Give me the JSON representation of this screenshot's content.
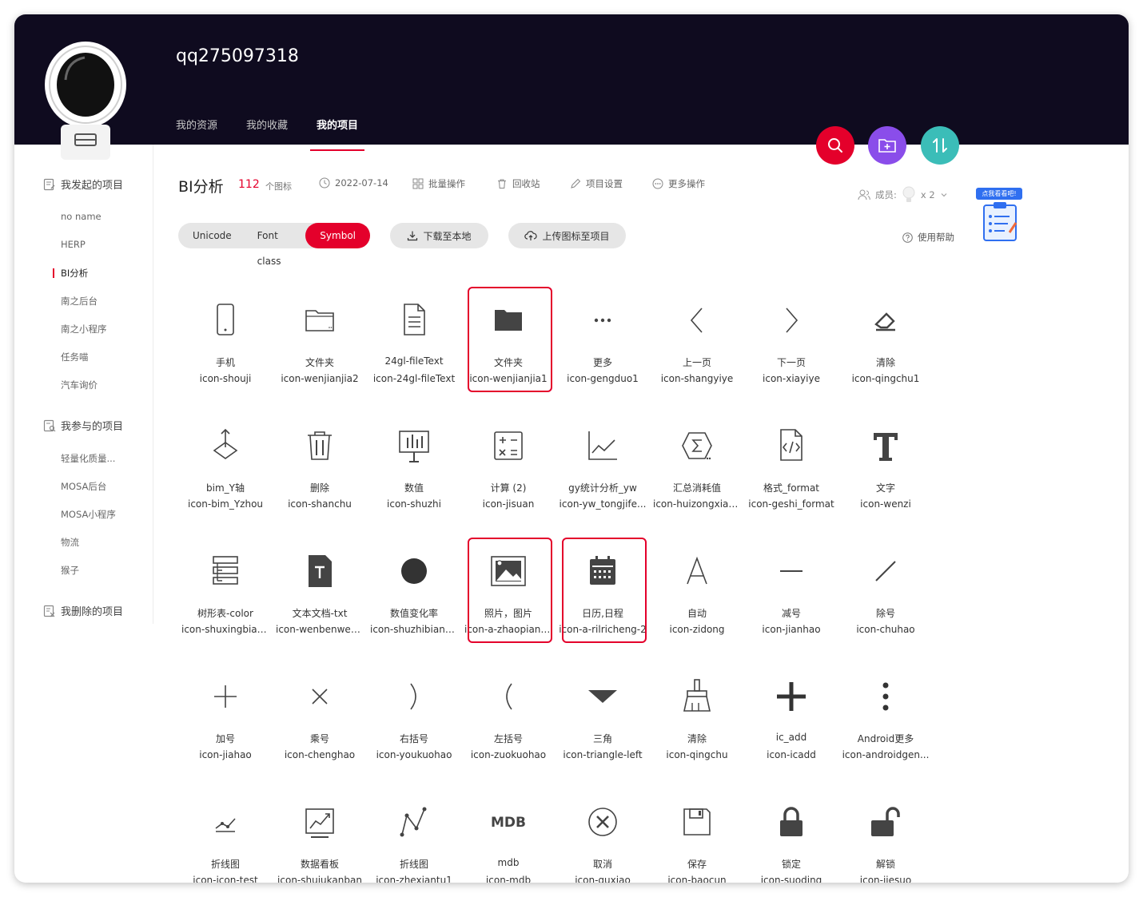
{
  "header": {
    "username": "qq275097318",
    "tabs": [
      {
        "label": "我的资源"
      },
      {
        "label": "我的收藏"
      },
      {
        "label": "我的项目"
      }
    ]
  },
  "sidebar": {
    "group_started": "我发起的项目",
    "started_items": [
      "no name",
      "HERP",
      "BI分析",
      "南之后台",
      "南之小程序",
      "任务喵",
      "汽车询价"
    ],
    "group_joined": "我参与的项目",
    "joined_items": [
      "轻量化质量...",
      "MOSA后台",
      "MOSA小程序",
      "物流",
      "猴子"
    ],
    "group_deleted": "我删除的项目"
  },
  "project": {
    "title": "BI分析",
    "count": "112",
    "count_unit": "个图标",
    "date": "2022-07-14",
    "batch": "批量操作",
    "recycle": "回收站",
    "settings": "项目设置",
    "more": "更多操作",
    "members_label": "成员:",
    "members_count": "x 2",
    "help": "使用帮助",
    "promo": "点我看看吧!"
  },
  "toolbar": {
    "unicode": "Unicode",
    "font_class": "Font class",
    "symbol": "Symbol",
    "download": "下载至本地",
    "upload": "上传图标至项目"
  },
  "icons": [
    {
      "name": "手机",
      "code": "icon-shouji",
      "glyph": "phone-icon"
    },
    {
      "name": "文件夹",
      "code": "icon-wenjianjia2",
      "glyph": "folder-outline-icon"
    },
    {
      "name": "24gl-fileText",
      "code": "icon-24gl-fileText",
      "glyph": "file-text-icon"
    },
    {
      "name": "文件夹",
      "code": "icon-wenjianjia1",
      "glyph": "folder-filled-icon"
    },
    {
      "name": "更多",
      "code": "icon-gengduo1",
      "glyph": "more-dots-icon"
    },
    {
      "name": "上一页",
      "code": "icon-shangyiye",
      "glyph": "chevron-left-icon"
    },
    {
      "name": "下一页",
      "code": "icon-xiayiye",
      "glyph": "chevron-right-icon"
    },
    {
      "name": "清除",
      "code": "icon-qingchu1",
      "glyph": "eraser-icon"
    },
    {
      "name": "bim_Y轴",
      "code": "icon-bim_Yzhou",
      "glyph": "axis-y-icon"
    },
    {
      "name": "删除",
      "code": "icon-shanchu",
      "glyph": "trash-icon"
    },
    {
      "name": "数值",
      "code": "icon-shuzhi",
      "glyph": "presentation-chart-icon"
    },
    {
      "name": "计算 (2)",
      "code": "icon-jisuan",
      "glyph": "calculator-icon"
    },
    {
      "name": "gy统计分析_yw",
      "code": "icon-yw_tongjife...",
      "glyph": "line-chart-icon"
    },
    {
      "name": "汇总消耗值",
      "code": "icon-huizongxiao...",
      "glyph": "sum-icon"
    },
    {
      "name": "格式_format",
      "code": "icon-geshi_format",
      "glyph": "code-file-icon"
    },
    {
      "name": "文字",
      "code": "icon-wenzi",
      "glyph": "text-t-icon"
    },
    {
      "name": "树形表-color",
      "code": "icon-shuxingbiao...",
      "glyph": "tree-table-icon"
    },
    {
      "name": "文本文档-txt",
      "code": "icon-wenbenwen...",
      "glyph": "txt-document-icon"
    },
    {
      "name": "数值变化率",
      "code": "icon-shuzhibianh...",
      "glyph": "filled-circle-icon"
    },
    {
      "name": "照片，图片",
      "code": "icon-a-zhaopiant...",
      "glyph": "image-icon"
    },
    {
      "name": "日历,日程",
      "code": "icon-a-rilricheng-2",
      "glyph": "calendar-icon"
    },
    {
      "name": "自动",
      "code": "icon-zidong",
      "glyph": "letter-a-icon"
    },
    {
      "name": "减号",
      "code": "icon-jianhao",
      "glyph": "minus-icon"
    },
    {
      "name": "除号",
      "code": "icon-chuhao",
      "glyph": "slash-icon"
    },
    {
      "name": "加号",
      "code": "icon-jiahao",
      "glyph": "plus-thin-icon"
    },
    {
      "name": "乘号",
      "code": "icon-chenghao",
      "glyph": "times-icon"
    },
    {
      "name": "右括号",
      "code": "icon-youkuohao",
      "glyph": "right-paren-icon"
    },
    {
      "name": "左括号",
      "code": "icon-zuokuohao",
      "glyph": "left-paren-icon"
    },
    {
      "name": "三角",
      "code": "icon-triangle-left",
      "glyph": "triangle-down-icon"
    },
    {
      "name": "清除",
      "code": "icon-qingchu",
      "glyph": "broom-icon"
    },
    {
      "name": "ic_add",
      "code": "icon-icadd",
      "glyph": "plus-bold-icon"
    },
    {
      "name": "Android更多",
      "code": "icon-androidgen...",
      "glyph": "vertical-dots-icon"
    },
    {
      "name": "折线图",
      "code": "icon-icon-test",
      "glyph": "small-line-chart-icon"
    },
    {
      "name": "数据看板",
      "code": "icon-shujukanban",
      "glyph": "dashboard-chart-icon"
    },
    {
      "name": "折线图",
      "code": "icon-zhexiantu1",
      "glyph": "polyline-icon"
    },
    {
      "name": "mdb",
      "code": "icon-mdb",
      "glyph": "mdb-text-icon"
    },
    {
      "name": "取消",
      "code": "icon-quxiao",
      "glyph": "cancel-circle-icon"
    },
    {
      "name": "保存",
      "code": "icon-baocun",
      "glyph": "save-icon"
    },
    {
      "name": "锁定",
      "code": "icon-suoding",
      "glyph": "lock-icon"
    },
    {
      "name": "解锁",
      "code": "icon-jiesuo",
      "glyph": "unlock-icon"
    }
  ],
  "colors": {
    "accent": "#e4002b",
    "header_bg": "#0f0b1f",
    "fab_purple": "#8a4dea",
    "fab_teal": "#3bbdb8"
  }
}
